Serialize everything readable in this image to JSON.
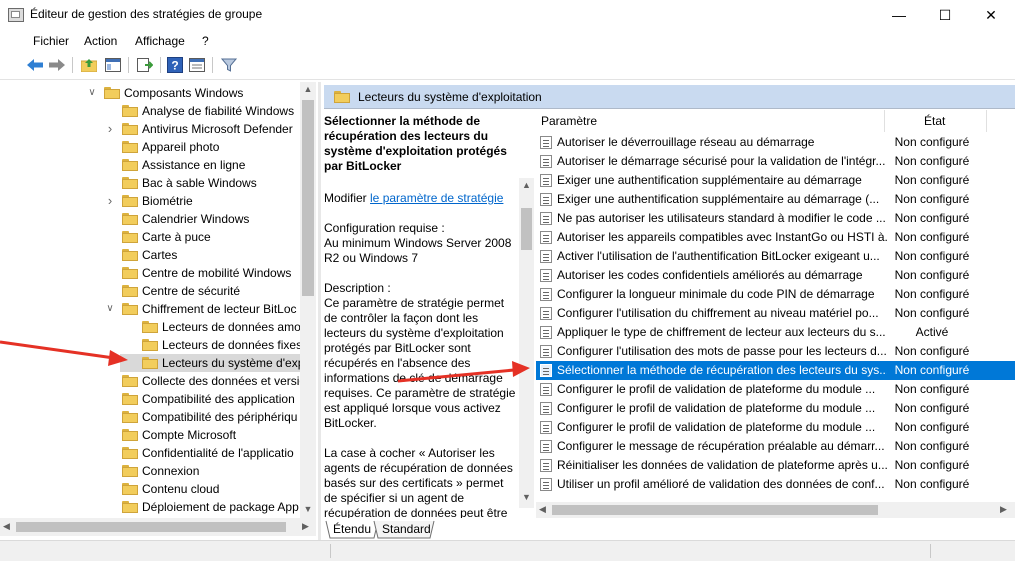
{
  "window": {
    "title": "Éditeur de gestion des stratégies de groupe",
    "minimize": "—",
    "maximize": "☐",
    "close": "✕"
  },
  "menu": [
    "Fichier",
    "Action",
    "Affichage",
    "?"
  ],
  "tree": [
    {
      "label": "Composants Windows",
      "expander": "expanded",
      "level": 0
    },
    {
      "label": "Analyse de fiabilité Windows",
      "expander": "none",
      "level": 1
    },
    {
      "label": "Antivirus Microsoft Defender",
      "expander": "collapsed",
      "level": 1
    },
    {
      "label": "Appareil photo",
      "expander": "none",
      "level": 1
    },
    {
      "label": "Assistance en ligne",
      "expander": "none",
      "level": 1
    },
    {
      "label": "Bac à sable Windows",
      "expander": "none",
      "level": 1
    },
    {
      "label": "Biométrie",
      "expander": "collapsed",
      "level": 1
    },
    {
      "label": "Calendrier Windows",
      "expander": "none",
      "level": 1
    },
    {
      "label": "Carte à puce",
      "expander": "none",
      "level": 1
    },
    {
      "label": "Cartes",
      "expander": "none",
      "level": 1
    },
    {
      "label": "Centre de mobilité Windows",
      "expander": "none",
      "level": 1
    },
    {
      "label": "Centre de sécurité",
      "expander": "none",
      "level": 1
    },
    {
      "label": "Chiffrement de lecteur BitLoc",
      "expander": "expanded",
      "level": 1
    },
    {
      "label": "Lecteurs de données amo",
      "expander": "none",
      "level": 2
    },
    {
      "label": "Lecteurs de données fixes",
      "expander": "none",
      "level": 2
    },
    {
      "label": "Lecteurs du système d'exp",
      "expander": "none",
      "level": 2,
      "selected": true
    },
    {
      "label": "Collecte des données et versio",
      "expander": "none",
      "level": 1
    },
    {
      "label": "Compatibilité des application",
      "expander": "none",
      "level": 1
    },
    {
      "label": "Compatibilité des périphériqu",
      "expander": "none",
      "level": 1
    },
    {
      "label": "Compte Microsoft",
      "expander": "none",
      "level": 1
    },
    {
      "label": "Confidentialité de l'applicatio",
      "expander": "none",
      "level": 1
    },
    {
      "label": "Connexion",
      "expander": "none",
      "level": 1
    },
    {
      "label": "Contenu cloud",
      "expander": "none",
      "level": 1
    },
    {
      "label": "Déploiement de package App",
      "expander": "none",
      "level": 1
    }
  ],
  "right": {
    "header": "Lecteurs du système d'exploitation",
    "desc": {
      "title": "Sélectionner la méthode de récupération des lecteurs du système d'exploitation protégés par BitLocker",
      "modify_prefix": "Modifier ",
      "modify_link": "le paramètre de stratégie",
      "req_label": "Configuration requise :",
      "req_value": "Au minimum Windows Server 2008 R2 ou Windows 7",
      "desc_label": "Description :",
      "desc_p1": "Ce paramètre de stratégie permet de contrôler la façon dont les lecteurs du système d'exploitation protégés par BitLocker sont récupérés en l'absence des informations de clé de démarrage requises. Ce paramètre de stratégie est appliqué lorsque vous activez BitLocker.",
      "desc_p2": "La case à cocher « Autoriser les agents de récupération de données basés sur des certificats » permet de spécifier si un agent de récupération de données peut être"
    },
    "columns": {
      "name": "Paramètre",
      "state": "État"
    },
    "policies": [
      {
        "name": "Autoriser le déverrouillage réseau au démarrage",
        "state": "Non configuré"
      },
      {
        "name": "Autoriser le démarrage sécurisé pour la validation de l'intégr...",
        "state": "Non configuré"
      },
      {
        "name": "Exiger une authentification supplémentaire au démarrage",
        "state": "Non configuré"
      },
      {
        "name": "Exiger une authentification supplémentaire au démarrage (...",
        "state": "Non configuré"
      },
      {
        "name": "Ne pas autoriser les utilisateurs standard à modifier le code ...",
        "state": "Non configuré"
      },
      {
        "name": "Autoriser les appareils compatibles avec InstantGo ou HSTI à...",
        "state": "Non configuré"
      },
      {
        "name": "Activer l'utilisation de l'authentification BitLocker exigeant u...",
        "state": "Non configuré"
      },
      {
        "name": "Autoriser les codes confidentiels améliorés au démarrage",
        "state": "Non configuré"
      },
      {
        "name": "Configurer la longueur minimale du code PIN de démarrage",
        "state": "Non configuré"
      },
      {
        "name": "Configurer l'utilisation du chiffrement au niveau matériel po...",
        "state": "Non configuré"
      },
      {
        "name": "Appliquer le type de chiffrement de lecteur aux lecteurs du s...",
        "state": "Activé"
      },
      {
        "name": "Configurer l'utilisation des mots de passe pour les lecteurs d...",
        "state": "Non configuré"
      },
      {
        "name": "Sélectionner la méthode de récupération des lecteurs du sys...",
        "state": "Non configuré",
        "selected": true
      },
      {
        "name": "Configurer le profil de validation de plateforme du module ...",
        "state": "Non configuré"
      },
      {
        "name": "Configurer le profil de validation de plateforme du module ...",
        "state": "Non configuré"
      },
      {
        "name": "Configurer le profil de validation de plateforme du module ...",
        "state": "Non configuré"
      },
      {
        "name": "Configurer le message de récupération préalable au démarr...",
        "state": "Non configuré"
      },
      {
        "name": "Réinitialiser les données de validation de plateforme après u...",
        "state": "Non configuré"
      },
      {
        "name": "Utiliser un profil amélioré de validation des données de conf...",
        "state": "Non configuré"
      }
    ],
    "tabs": [
      "Étendu",
      "Standard"
    ]
  },
  "colors": {
    "selection": "#0078d7",
    "header_bg": "#c9daf0",
    "arrow": "#e53125"
  }
}
